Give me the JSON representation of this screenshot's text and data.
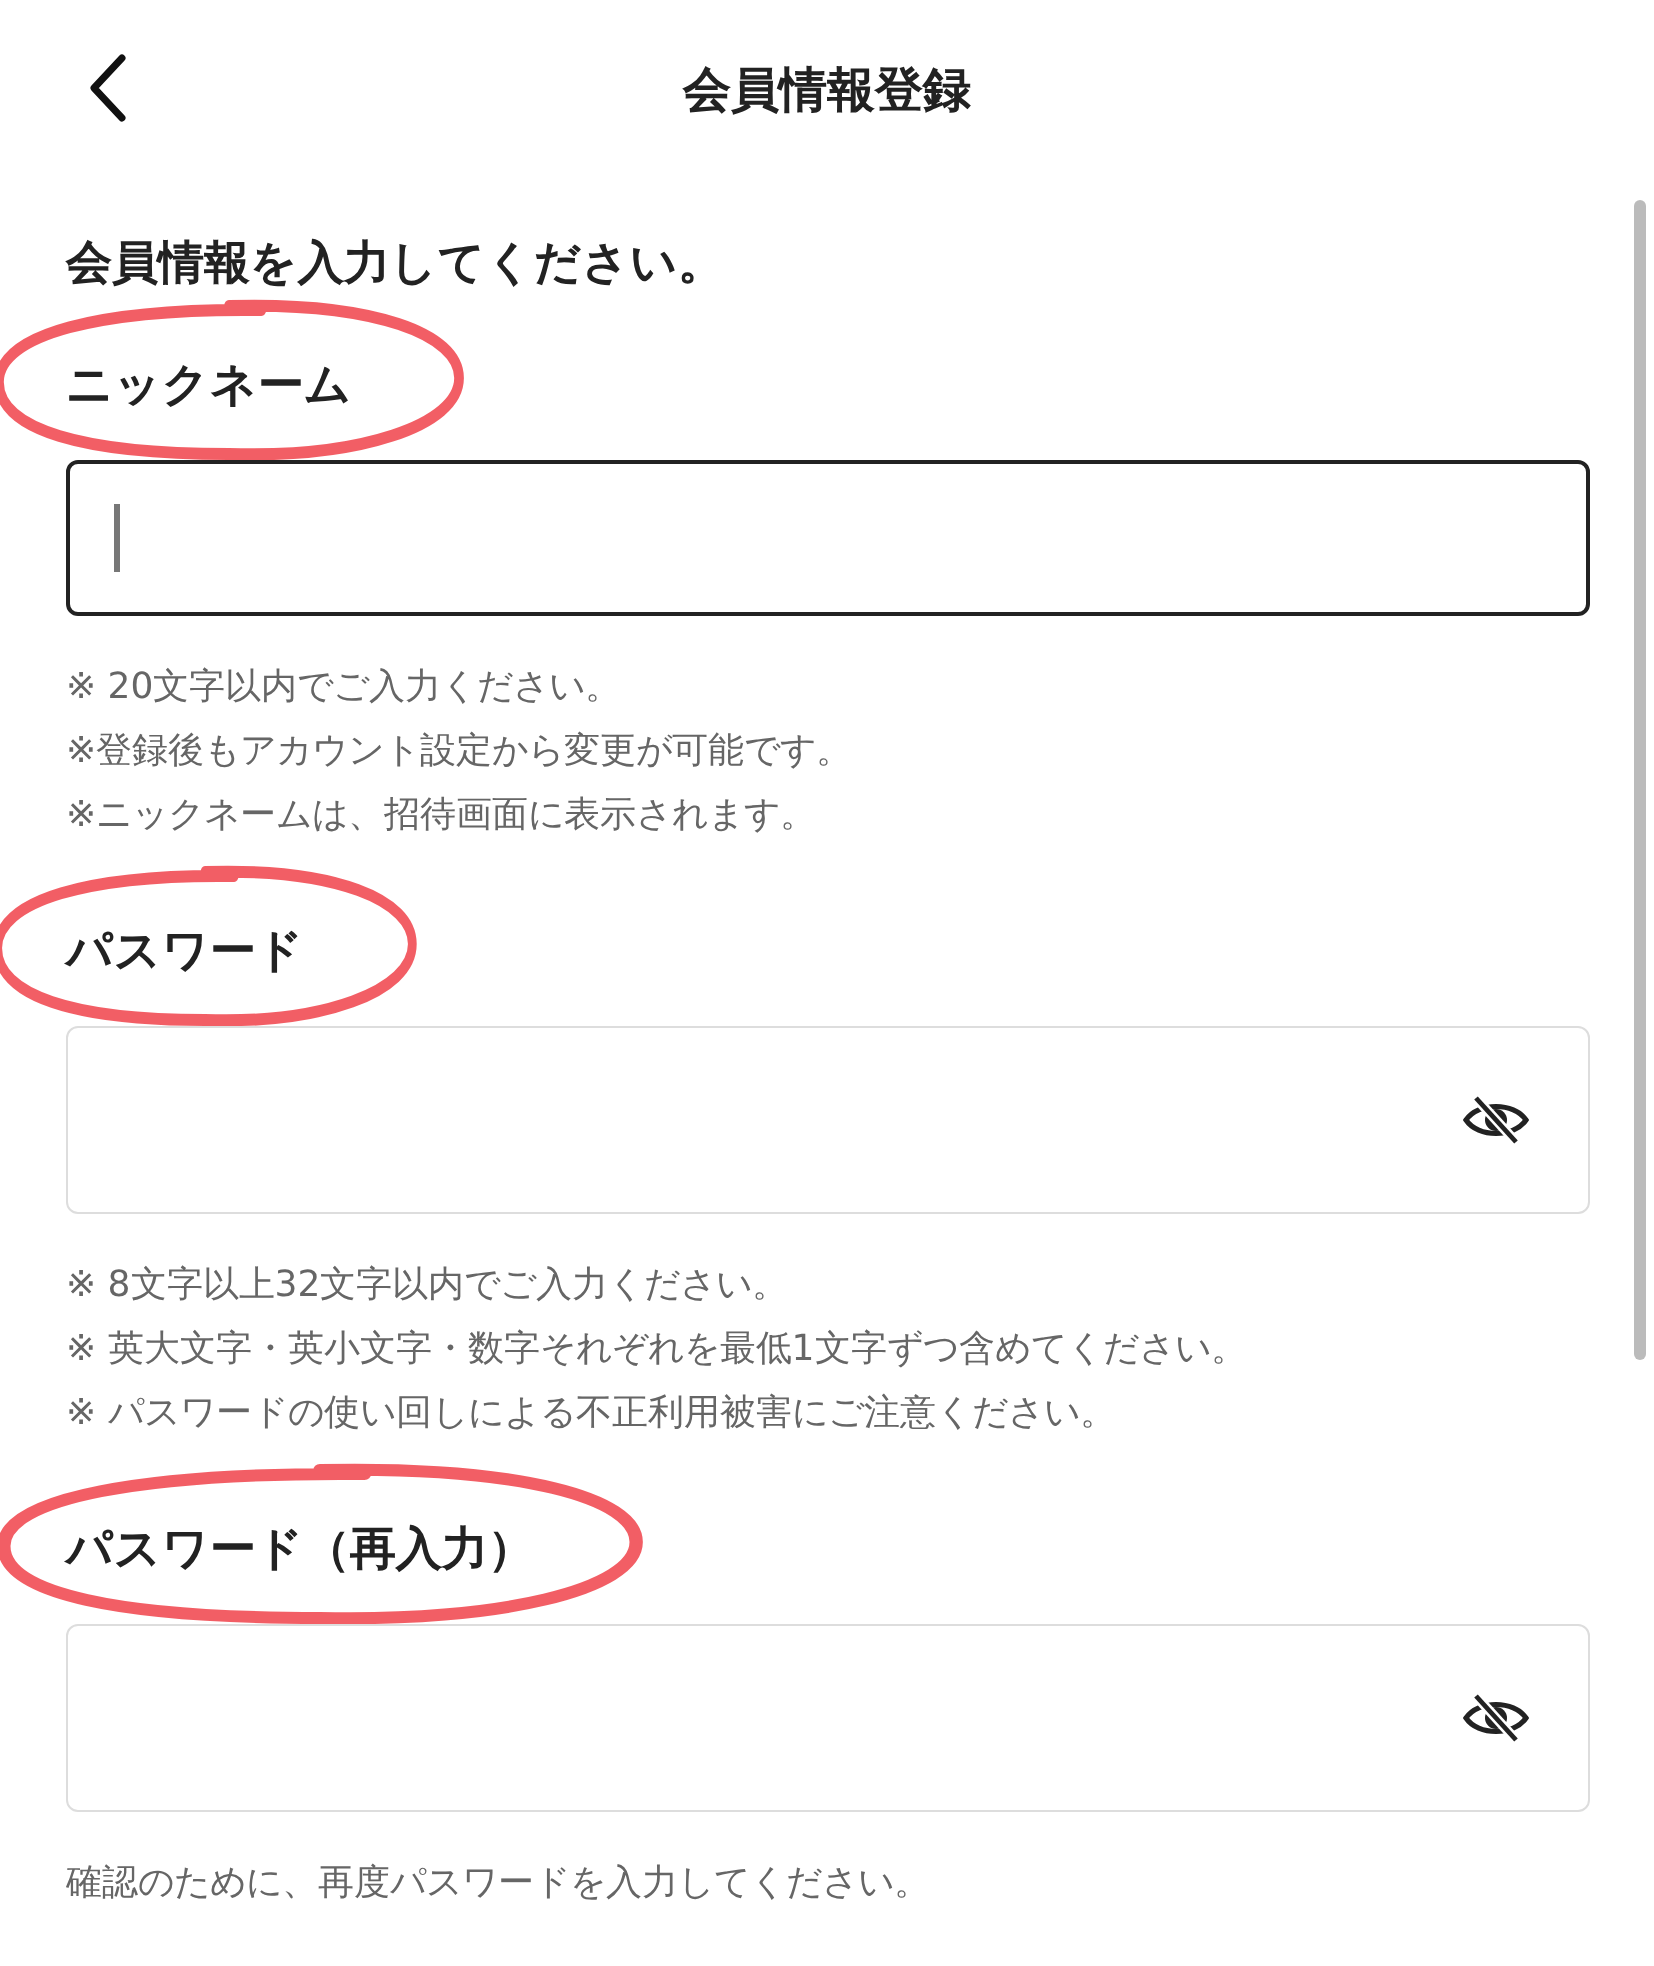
{
  "header": {
    "title": "会員情報登録"
  },
  "intro": "会員情報を入力してください。",
  "fields": [
    {
      "label": "ニックネーム",
      "circled": true,
      "kind": "text",
      "focused": true,
      "notes": [
        "※ 20文字以内でご入力ください。",
        "※登録後もアカウント設定から変更が可能です。",
        "※ニックネームは、招待画面に表示されます。"
      ]
    },
    {
      "label": "パスワード",
      "circled": true,
      "kind": "password",
      "focused": false,
      "notes": [
        "※ 8文字以上32文字以内でご入力ください。",
        "※ 英大文字・英小文字・数字それぞれを最低1文字ずつ含めてください。",
        "※ パスワードの使い回しによる不正利用被害にご注意ください。"
      ]
    },
    {
      "label": "パスワード（再入力）",
      "circled": true,
      "kind": "password",
      "focused": false,
      "notes": [
        "確認のために、再度パスワードを入力してください。"
      ]
    }
  ]
}
